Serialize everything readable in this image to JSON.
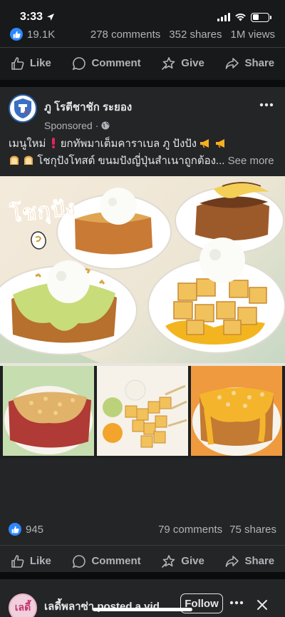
{
  "status_bar": {
    "time": "3:33"
  },
  "previous_post": {
    "reaction_count": "19.1K",
    "comments": "278 comments",
    "shares": "352 shares",
    "views": "1M views"
  },
  "actions": {
    "like": "Like",
    "comment": "Comment",
    "give": "Give",
    "share": "Share"
  },
  "post": {
    "page_name": "ภู โรตีชาชัก ระยอง",
    "sponsored": "Sponsored ·",
    "caption_line1_a": "เมนูใหม่",
    "caption_line1_b": "ยกทัพมาเต็มคาราเบล ภู ปังปัง",
    "caption_line2": "โชกุปังโทสต์ ขนมปังญี่ปุ่นสำเนาถูกต้อง...",
    "see_more": "See more",
    "image_title": "โชกุปัง",
    "reaction_count": "945",
    "comments": "79 comments",
    "shares": "75 shares"
  },
  "next_post": {
    "avatar_text": "เลดี้",
    "title": "เลดี้พลาซ่า posted a vid...",
    "follow": "Follow"
  },
  "colors": {
    "background": "#18191a",
    "card": "#242526",
    "accent": "#2d88ff",
    "muted": "#b0b3b8"
  }
}
